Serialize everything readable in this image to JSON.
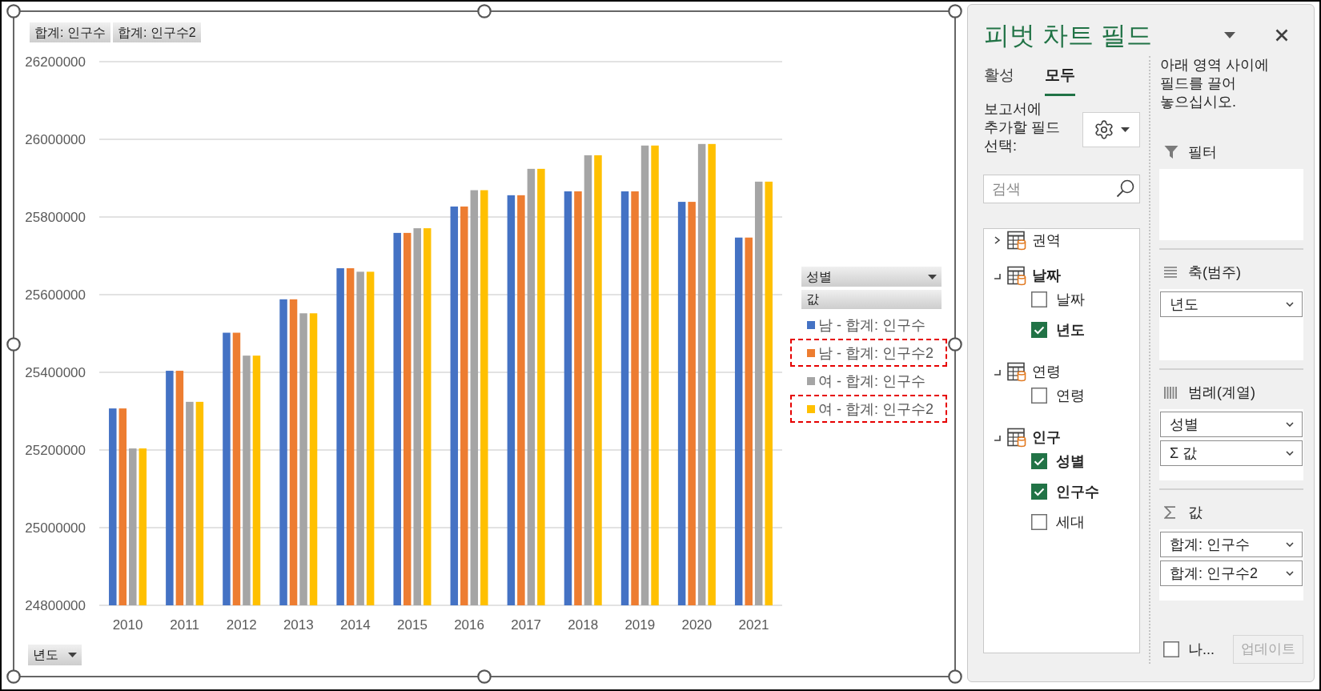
{
  "chart": {
    "value_field_buttons": [
      "합계: 인구수",
      "합계: 인구수2"
    ],
    "chart_data": {
      "type": "bar",
      "grid": true,
      "categories": [
        "2010",
        "2011",
        "2012",
        "2013",
        "2014",
        "2015",
        "2016",
        "2017",
        "2018",
        "2019",
        "2020",
        "2021"
      ],
      "series": [
        {
          "name": "남 - 합계: 인구수",
          "color": "#4472c4",
          "values": [
            25307000,
            25404000,
            25502000,
            25588000,
            25668000,
            25759000,
            25827000,
            25856000,
            25866000,
            25866000,
            25839000,
            25747000
          ]
        },
        {
          "name": "남 - 합계: 인구수2",
          "color": "#ed7d31",
          "values": [
            25307000,
            25404000,
            25502000,
            25588000,
            25668000,
            25759000,
            25827000,
            25856000,
            25866000,
            25866000,
            25839000,
            25747000
          ]
        },
        {
          "name": "여 - 합계: 인구수",
          "color": "#a5a5a5",
          "values": [
            25204000,
            25324000,
            25443000,
            25552000,
            25659000,
            25771000,
            25869000,
            25924000,
            25959000,
            25984000,
            25988000,
            25891000
          ]
        },
        {
          "name": "여 - 합계: 인구수2",
          "color": "#ffc000",
          "values": [
            25204000,
            25324000,
            25443000,
            25552000,
            25659000,
            25771000,
            25869000,
            25924000,
            25959000,
            25984000,
            25988000,
            25891000
          ]
        }
      ],
      "ylim": [
        24800000,
        26200000
      ],
      "yticks": [
        24800000,
        25000000,
        25200000,
        25400000,
        25600000,
        25800000,
        26000000,
        26200000
      ]
    },
    "legend": {
      "field_button": "성별",
      "values_button": "값",
      "items": [
        {
          "highlighted": false
        },
        {
          "highlighted": true
        },
        {
          "highlighted": false
        },
        {
          "highlighted": true
        }
      ]
    },
    "axis_field_button": "년도"
  },
  "pivot_panel": {
    "title": "피벗 차트 필드",
    "tabs": [
      {
        "label": "활성",
        "selected": false
      },
      {
        "label": "모두",
        "selected": true
      }
    ],
    "field_list_label": "보고서에 추가할 필드 선택:",
    "search": {
      "placeholder": "검색"
    },
    "field_tree": [
      {
        "name": "권역",
        "expanded": false
      },
      {
        "name": "날짜",
        "expanded": true,
        "children": [
          {
            "name": "날짜",
            "checked": false
          },
          {
            "name": "년도",
            "checked": true
          }
        ]
      },
      {
        "name": "연령",
        "expanded": true,
        "children": [
          {
            "name": "연령",
            "checked": false
          }
        ]
      },
      {
        "name": "인구",
        "expanded": true,
        "children": [
          {
            "name": "성별",
            "checked": true
          },
          {
            "name": "인구수",
            "checked": true
          },
          {
            "name": "세대",
            "checked": false
          }
        ]
      }
    ],
    "areas_hint": "아래 영역 사이에 필드를 끌어 놓으십시오.",
    "areas": [
      {
        "kind": "filter",
        "title": "필터"
      },
      {
        "kind": "axis",
        "title": "축(범주)",
        "items": [
          "년도"
        ]
      },
      {
        "kind": "legend",
        "title": "범례(계열)",
        "items": [
          "성별",
          "Σ 값"
        ]
      },
      {
        "kind": "values",
        "title": "값",
        "items": [
          "합계: 인구수",
          "합계: 인구수2"
        ]
      }
    ],
    "defer_update": {
      "label": "나...",
      "checked": false
    },
    "update_button": {
      "label": "업데이트",
      "disabled": true
    }
  }
}
